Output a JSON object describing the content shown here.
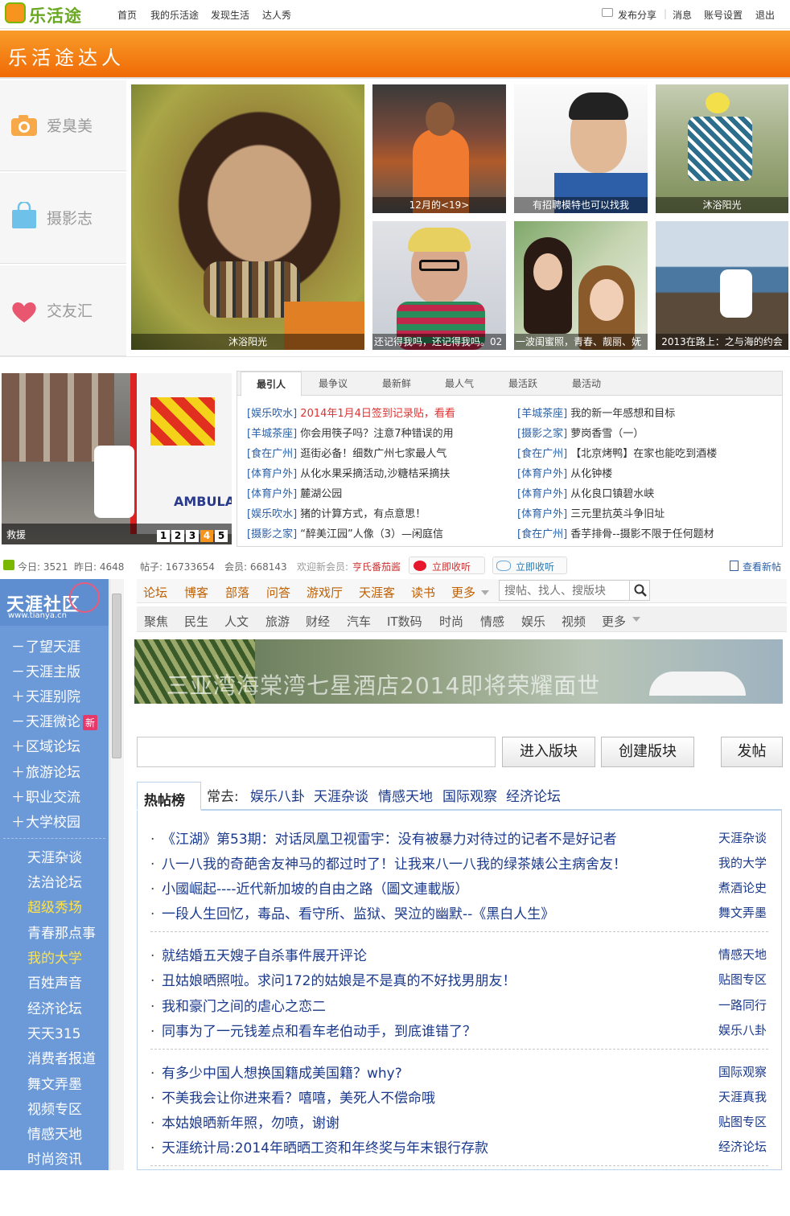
{
  "app": {
    "logo_text": "乐活途"
  },
  "topnav": {
    "links": [
      "首页",
      "我的乐活途",
      "发现生活",
      "达人秀"
    ],
    "publish": "发布分享",
    "messages": "消息",
    "account": "账号设置",
    "logout": "退出"
  },
  "banner": {
    "title": "乐活途达人"
  },
  "categories": [
    {
      "label": "爱臭美",
      "icon": "camera-icon"
    },
    {
      "label": "摄影志",
      "icon": "bag-icon"
    },
    {
      "label": "交友汇",
      "icon": "heart-icon"
    }
  ],
  "photos": {
    "main_caption": "沐浴阳光",
    "grid": [
      "12月的<19>",
      "有招聘模特也可以找我",
      "沐浴阳光",
      "还记得我吗，还记得我吗。02",
      "一波闺蜜照，青春、靓丽、妩",
      "2013在路上：之与海的约会"
    ]
  },
  "slideshow": {
    "caption": "救援",
    "pages": [
      "1",
      "2",
      "3",
      "4",
      "5"
    ],
    "active_page": "4",
    "brand_text": "AMBULA"
  },
  "tabs": [
    "最引人",
    "最争议",
    "最新鲜",
    "最人气",
    "最活跃",
    "最活动"
  ],
  "news_left": [
    {
      "tag": "[娱乐吹水]",
      "title": "2014年1月4日签到记录贴，看看",
      "highlight": true
    },
    {
      "tag": "[羊城茶座]",
      "title": "你会用筷子吗？注意7种错误的用"
    },
    {
      "tag": "[食在广州]",
      "title": "逛街必备！细数广州七家最人气"
    },
    {
      "tag": "[体育户外]",
      "title": "从化水果采摘活动,沙糖桔采摘扶"
    },
    {
      "tag": "[体育户外]",
      "title": "麓湖公园"
    },
    {
      "tag": "[娱乐吹水]",
      "title": "猪的计算方式，有点意思！"
    },
    {
      "tag": "[摄影之家]",
      "title": "“醉美江园”人像（3）—闲庭信"
    }
  ],
  "news_right": [
    {
      "tag": "[羊城茶座]",
      "title": "我的新一年感想和目标"
    },
    {
      "tag": "[摄影之家]",
      "title": "萝岗香雪（一）"
    },
    {
      "tag": "[食在广州]",
      "title": "【北京烤鸭】在家也能吃到酒楼"
    },
    {
      "tag": "[体育户外]",
      "title": "从化钟楼"
    },
    {
      "tag": "[体育户外]",
      "title": "从化良口镇碧水峡"
    },
    {
      "tag": "[体育户外]",
      "title": "三元里抗英斗争旧址"
    },
    {
      "tag": "[食在广州]",
      "title": "香芋排骨--摄影不限于任何题材"
    }
  ],
  "stats": {
    "today": "今日: 3521",
    "yesterday": "昨日: 4648",
    "posts": "帖子: 16733654",
    "members": "会员: 668143",
    "welcome": "欢迎新会员:",
    "new_member": "亨氏番茄酱",
    "listen1": "立即收听",
    "listen2": "立即收听",
    "view_new": "查看新帖"
  },
  "tianya": {
    "logo": "天涯社区",
    "logo_url": "www.tianya.cn",
    "nav1": [
      "论坛",
      "博客",
      "部落",
      "问答",
      "游戏厅",
      "天涯客",
      "读书",
      "更多"
    ],
    "nav2": [
      "聚焦",
      "民生",
      "人文",
      "旅游",
      "财经",
      "汽车",
      "IT数码",
      "时尚",
      "情感",
      "娱乐",
      "视频",
      "更多"
    ],
    "search_placeholder": "搜帖、找人、搜版块",
    "sidebar_top": [
      {
        "pre": "－",
        "label": "了望天涯"
      },
      {
        "pre": "－",
        "label": "天涯主版"
      },
      {
        "pre": "＋",
        "label": "天涯别院"
      },
      {
        "pre": "－",
        "label": "天涯微论",
        "badge": "新"
      },
      {
        "pre": "＋",
        "label": "区域论坛"
      },
      {
        "pre": "＋",
        "label": "旅游论坛"
      },
      {
        "pre": "＋",
        "label": "职业交流"
      },
      {
        "pre": "＋",
        "label": "大学校园"
      }
    ],
    "sidebar_boards": [
      {
        "label": "天涯杂谈"
      },
      {
        "label": "法治论坛"
      },
      {
        "label": "超级秀场",
        "hl": true
      },
      {
        "label": "青春那点事"
      },
      {
        "label": "我的大学",
        "hl": true
      },
      {
        "label": "百姓声音"
      },
      {
        "label": "经济论坛"
      },
      {
        "label": "天天315"
      },
      {
        "label": "消费者报道"
      },
      {
        "label": "舞文弄墨"
      },
      {
        "label": "视频专区"
      },
      {
        "label": "情感天地"
      },
      {
        "label": "时尚资讯"
      }
    ],
    "ad_text": "三亚湾海棠湾七星酒店2014即将荣耀面世",
    "btn_enter": "进入版块",
    "btn_create": "创建版块",
    "btn_post": "发帖",
    "hot_title": "热帖榜",
    "frequent_label": "常去:",
    "frequent": [
      "娱乐八卦",
      "天涯杂谈",
      "情感天地",
      "国际观察",
      "经济论坛"
    ],
    "hot_groups": [
      [
        {
          "title": "《江湖》第53期：对话凤凰卫视雷宇：没有被暴力对待过的记者不是好记者",
          "board": "天涯杂谈"
        },
        {
          "title": "八一八我的奇葩舍友神马的都过时了！让我来八一八我的绿茶婊公主病舍友！",
          "board": "我的大学"
        },
        {
          "title": "小國崛起----近代新加坡的自由之路（圖文連載版）",
          "board": "煮酒论史"
        },
        {
          "title": "一段人生回忆，毒品、看守所、监狱、哭泣的幽默--《黑白人生》",
          "board": "舞文弄墨"
        }
      ],
      [
        {
          "title": "就结婚五天嫂子自杀事件展开评论",
          "board": "情感天地"
        },
        {
          "title": "丑姑娘晒照啦。求问172的姑娘是不是真的不好找男朋友！",
          "board": "贴图专区"
        },
        {
          "title": "我和豪门之间的虐心之恋二",
          "board": "一路同行"
        },
        {
          "title": "同事为了一元钱差点和看车老伯动手，到底谁错了？",
          "board": "娱乐八卦"
        }
      ],
      [
        {
          "title": "有多少中国人想换国籍成美国籍？why?",
          "board": "国际观察"
        },
        {
          "title": "不美我会让你进来看？嘻嘻，美死人不偿命哦",
          "board": "天涯真我"
        },
        {
          "title": "本姑娘晒新年照，勿喷，谢谢",
          "board": "贴图专区"
        },
        {
          "title": "天涯统计局:2014年晒晒工资和年终奖与年末银行存款",
          "board": "经济论坛"
        }
      ]
    ]
  },
  "colors": {
    "orange": "#f07a10",
    "green": "#6aa822",
    "link_blue": "#2b5fa6",
    "sidebar_blue": "#6c9ad8",
    "highlight_yellow": "#ffe34a"
  }
}
